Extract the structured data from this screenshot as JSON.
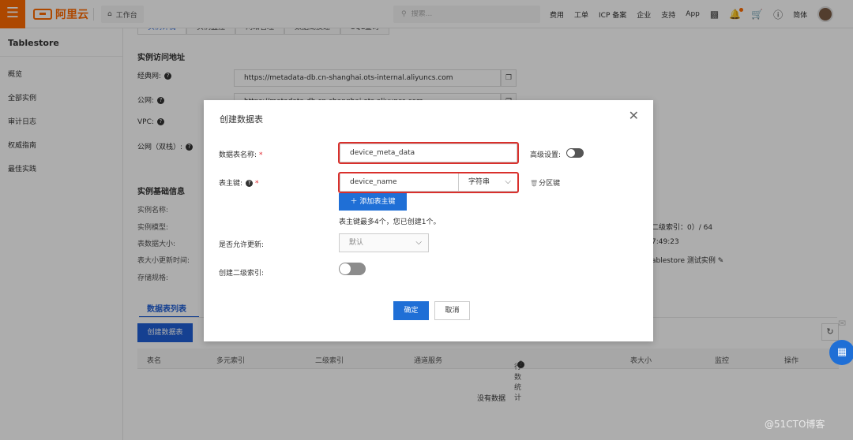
{
  "topbar": {
    "logo_text": "阿里云",
    "workbench": "工作台",
    "search_placeholder": "搜索...",
    "nav": [
      "费用",
      "工单",
      "ICP 备案",
      "企业",
      "支持",
      "App"
    ],
    "lang": "简体"
  },
  "sidebar": {
    "title": "Tablestore",
    "items": [
      "概览",
      "全部实例",
      "审计日志",
      "权威指南",
      "最佳实践"
    ]
  },
  "main": {
    "tabs": [
      "实例详情",
      "实例监控",
      "网络管理",
      "数据湖投递",
      "SQL查询"
    ],
    "access_title": "实例访问地址",
    "labels": {
      "classic": "经典网:",
      "public": "公网:",
      "vpc": "VPC:",
      "dual": "公网（双栈）:"
    },
    "classic_url": "https://metadata-db.cn-shanghai.ots-internal.aliyuncs.com",
    "public_url": "https://metadata-db.cn-shanghai.ots.aliyuncs.com",
    "basic_title": "实例基础信息",
    "info_labels": [
      "实例名称:",
      "实例模型:",
      "表数据大小:",
      "表大小更新时间:",
      "存储规格:"
    ],
    "info_right": [
      "二级索引：0）/ 64",
      "7:49:23",
      "ablestore 测试实例"
    ],
    "table_tab": "数据表列表",
    "create_table": "创建数据表",
    "columns": [
      "表名",
      "多元索引",
      "二级索引",
      "通道服务",
      "行数统计",
      "表大小",
      "监控",
      "操作"
    ],
    "empty": "没有数据"
  },
  "modal": {
    "title": "创建数据表",
    "table_name_label": "数据表名称:",
    "table_name_value": "device_meta_data",
    "advanced_label": "高级设置:",
    "pk_label": "表主键:",
    "pk_name_value": "device_name",
    "pk_type": "字符串",
    "partition_key": "分区键",
    "add_pk": "添加表主键",
    "hint": "表主键最多4个，您已创建1个。",
    "allow_update_label": "是否允许更新:",
    "allow_update_value": "默认",
    "secondary_index_label": "创建二级索引:",
    "ok": "确定",
    "cancel": "取消"
  },
  "watermark": "@51CTO博客",
  "colors": {
    "brand": "#ff6a00",
    "primary": "#1f6fd6",
    "highlight": "#d9302c",
    "required": "#e0262d"
  }
}
